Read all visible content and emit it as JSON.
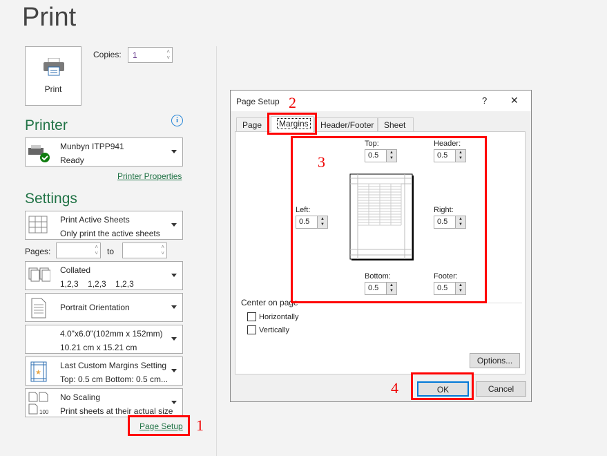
{
  "title": "Print",
  "print_button": "Print",
  "copies": {
    "label": "Copies:",
    "value": "1"
  },
  "printer": {
    "heading": "Printer",
    "name": "Munbyn ITPP941",
    "status": "Ready",
    "properties_link": "Printer Properties"
  },
  "settings": {
    "heading": "Settings",
    "pages_label": "Pages:",
    "to_label": "to",
    "items": [
      {
        "l1": "Print Active Sheets",
        "l2": "Only print the active sheets"
      },
      {
        "l1": "Collated",
        "l2": "1,2,3    1,2,3    1,2,3"
      },
      {
        "l1": "Portrait Orientation",
        "l2": ""
      },
      {
        "l1": "4.0\"x6.0\"(102mm x 152mm)",
        "l2": "10.21 cm x 15.21 cm"
      },
      {
        "l1": "Last Custom Margins Setting",
        "l2": "Top: 0.5 cm Bottom: 0.5 cm..."
      },
      {
        "l1": "No Scaling",
        "l2": "Print sheets at their actual size"
      }
    ],
    "page_setup_link": "Page Setup"
  },
  "annotations": [
    "1",
    "2",
    "3",
    "4"
  ],
  "dialog": {
    "title": "Page Setup",
    "help": "?",
    "close": "✕",
    "tabs": [
      "Page",
      "Margins",
      "Header/Footer",
      "Sheet"
    ],
    "active_tab": "Margins",
    "fields": {
      "top": {
        "label": "Top:",
        "value": "0.5"
      },
      "header": {
        "label": "Header:",
        "value": "0.5"
      },
      "left": {
        "label": "Left:",
        "value": "0.5"
      },
      "right": {
        "label": "Right:",
        "value": "0.5"
      },
      "bottom": {
        "label": "Bottom:",
        "value": "0.5"
      },
      "footer": {
        "label": "Footer:",
        "value": "0.5"
      }
    },
    "center_on_page": "Center on page",
    "horizontally": "Horizontally",
    "vertically": "Vertically",
    "options": "Options...",
    "ok": "OK",
    "cancel": "Cancel"
  },
  "colors": {
    "accent": "#217346",
    "annotation": "#ff0000"
  }
}
